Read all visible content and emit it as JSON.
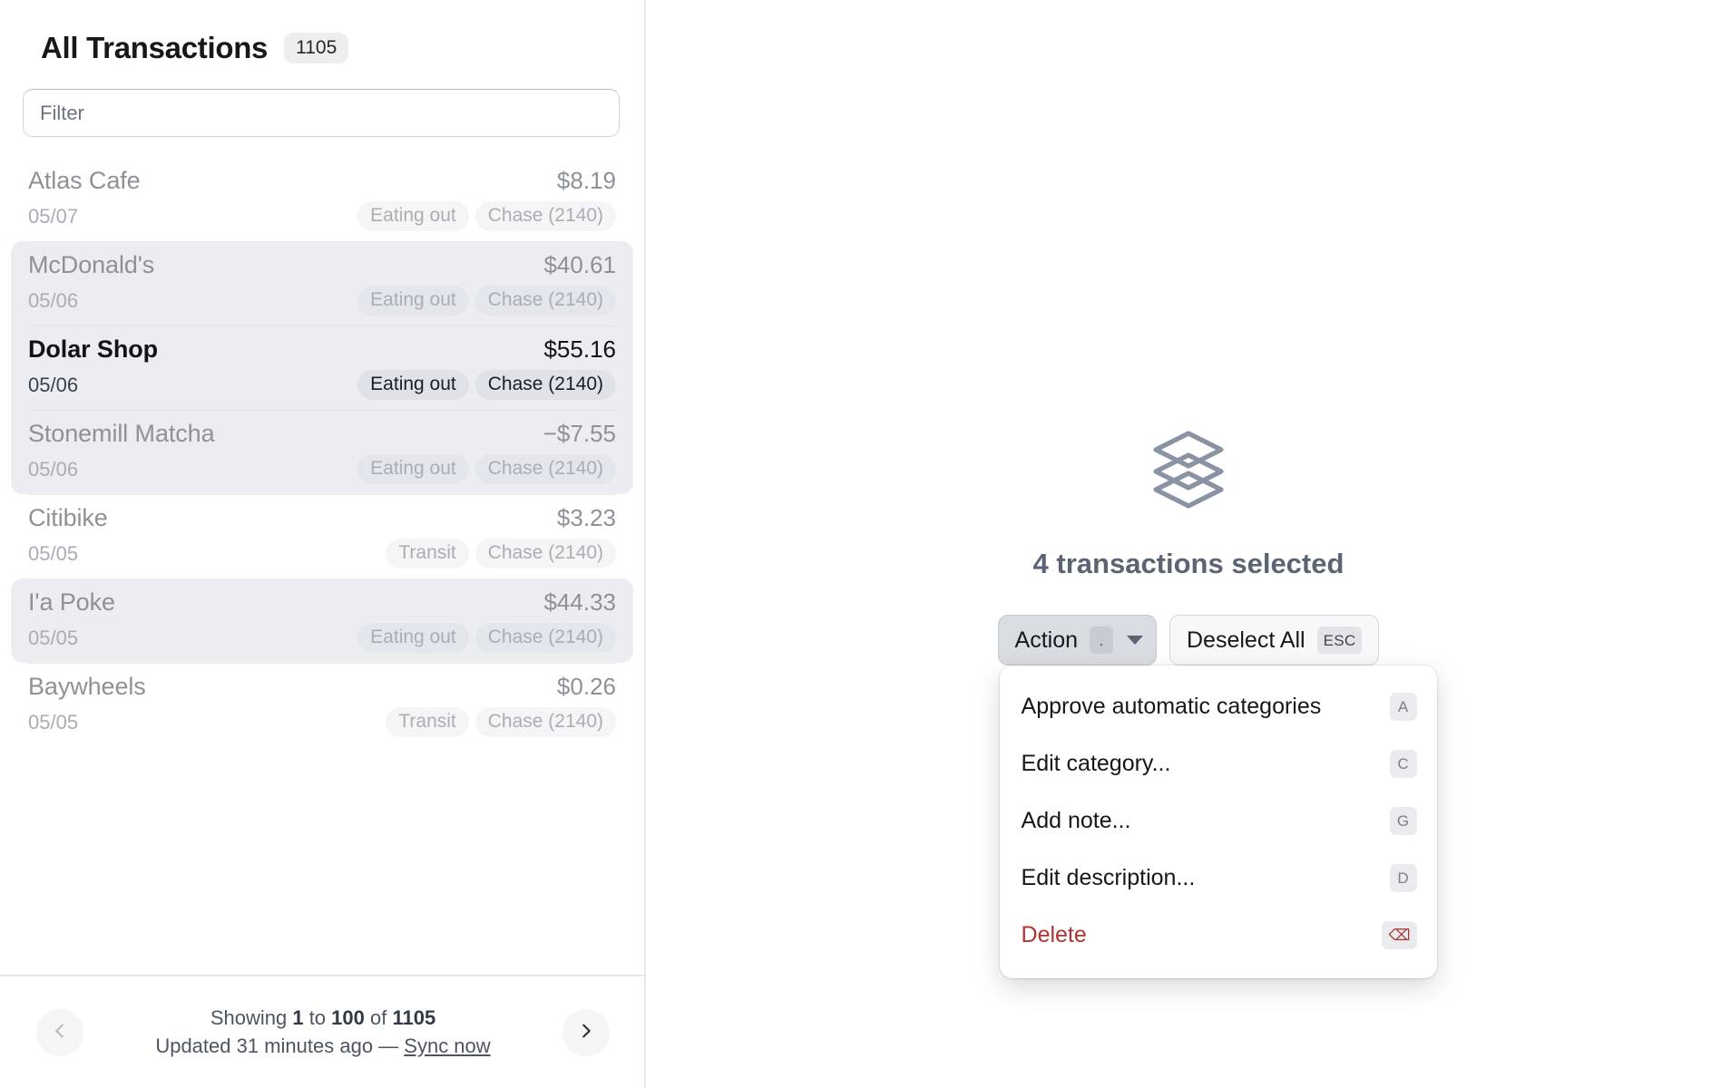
{
  "sidebar": {
    "title": "All Transactions",
    "count_badge": "1105",
    "filter": {
      "placeholder": "Filter",
      "value": ""
    },
    "groups": [
      {
        "selected": false,
        "rows": [
          {
            "name": "Atlas Cafe",
            "amount": "$8.19",
            "date": "05/07",
            "tags": [
              "Eating out",
              "Chase (2140)"
            ],
            "focused": false
          }
        ]
      },
      {
        "selected": true,
        "rows": [
          {
            "name": "McDonald's",
            "amount": "$40.61",
            "date": "05/06",
            "tags": [
              "Eating out",
              "Chase (2140)"
            ],
            "focused": false
          },
          {
            "name": "Dolar Shop",
            "amount": "$55.16",
            "date": "05/06",
            "tags": [
              "Eating out",
              "Chase (2140)"
            ],
            "focused": true
          },
          {
            "name": "Stonemill Matcha",
            "amount": "−$7.55",
            "date": "05/06",
            "tags": [
              "Eating out",
              "Chase (2140)"
            ],
            "focused": false
          }
        ]
      },
      {
        "selected": false,
        "rows": [
          {
            "name": "Citibike",
            "amount": "$3.23",
            "date": "05/05",
            "tags": [
              "Transit",
              "Chase (2140)"
            ],
            "focused": false
          }
        ]
      },
      {
        "selected": true,
        "rows": [
          {
            "name": "I'a Poke",
            "amount": "$44.33",
            "date": "05/05",
            "tags": [
              "Eating out",
              "Chase (2140)"
            ],
            "focused": false
          }
        ]
      },
      {
        "selected": false,
        "rows": [
          {
            "name": "Baywheels",
            "amount": "$0.26",
            "date": "05/05",
            "tags": [
              "Transit",
              "Chase (2140)"
            ],
            "focused": false
          }
        ]
      }
    ],
    "footer": {
      "prev_icon": "chevron-left-icon",
      "next_icon": "chevron-right-icon",
      "showing_prefix": "Showing ",
      "showing_from": "1",
      "showing_mid": " to ",
      "showing_to": "100",
      "showing_of": " of ",
      "showing_total": "1105",
      "updated_text": "Updated 31 minutes ago — ",
      "sync_link": "Sync now"
    }
  },
  "main": {
    "empty_icon": "layers-stack-icon",
    "selected_label": "4 transactions selected",
    "action_button": {
      "label": "Action",
      "kbd": ".",
      "caret_icon": "chevron-down-icon"
    },
    "deselect_button": {
      "label": "Deselect All",
      "kbd": "ESC"
    },
    "menu": {
      "items": [
        {
          "label": "Approve automatic categories",
          "kbd": "A",
          "danger": false
        },
        {
          "label": "Edit category...",
          "kbd": "C",
          "danger": false
        },
        {
          "label": "Add note...",
          "kbd": "G",
          "danger": false
        },
        {
          "label": "Edit description...",
          "kbd": "D",
          "danger": false
        },
        {
          "label": "Delete",
          "kbd": "⌫",
          "danger": true,
          "kbd_icon": "backspace-icon"
        }
      ]
    }
  },
  "colors": {
    "selection_bg": "#ebedf0",
    "danger": "#b3322f",
    "muted_text": "#8d9299",
    "icon_slate": "#8a93a3",
    "divider": "#e6e8eb"
  }
}
